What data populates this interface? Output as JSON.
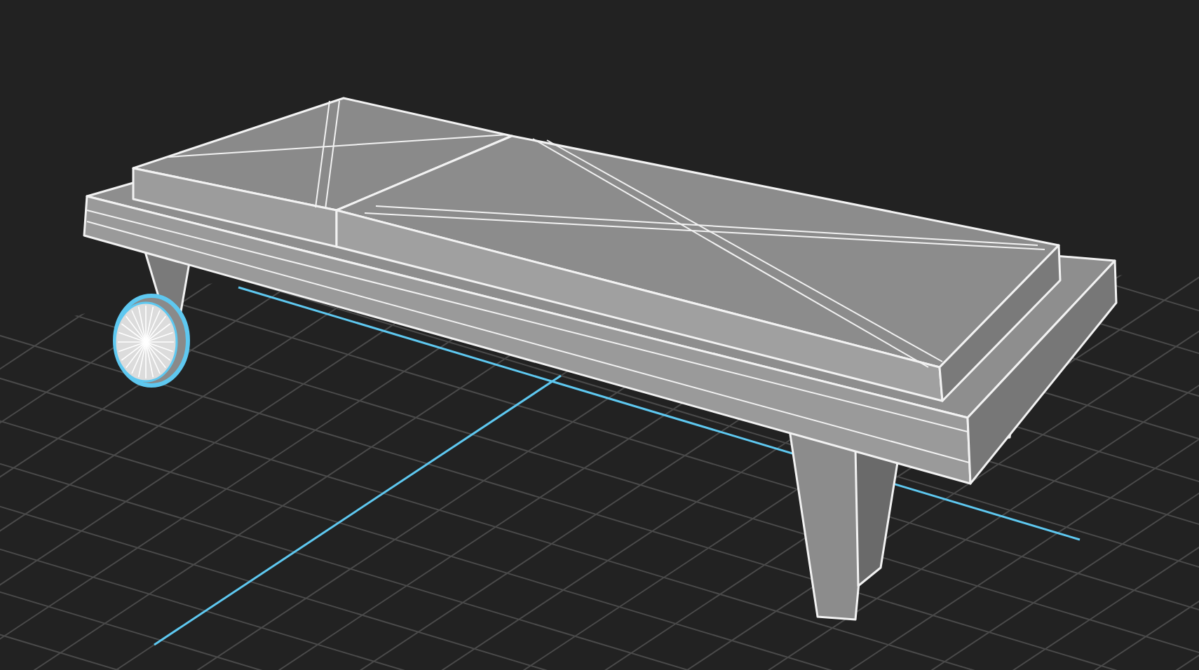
{
  "viewport": {
    "objects": [
      {
        "kind": "lounger",
        "selected": false
      },
      {
        "kind": "wheel",
        "selected": true
      }
    ]
  }
}
